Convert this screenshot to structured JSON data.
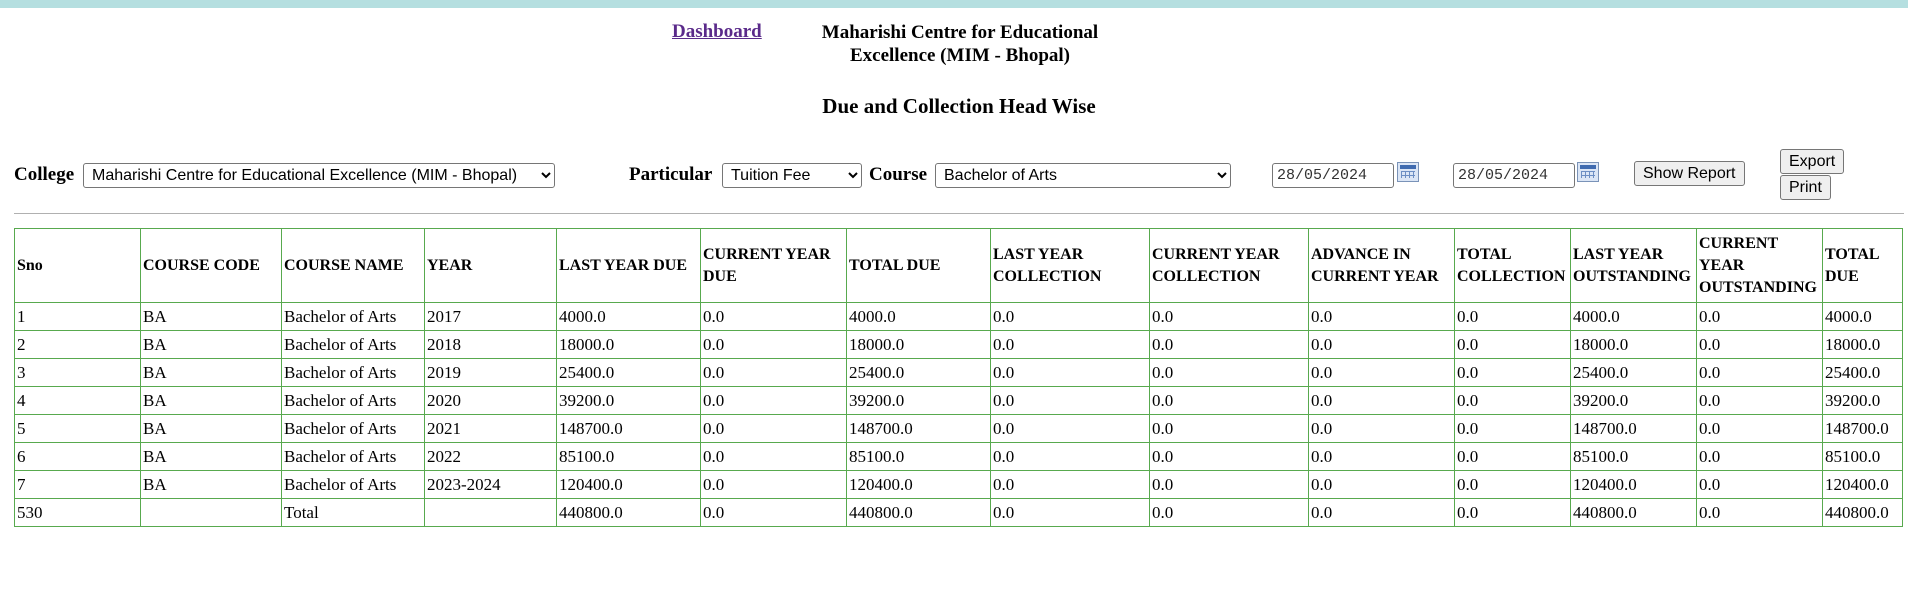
{
  "header": {
    "dashboard_link": "Dashboard",
    "org_line1": "Maharishi Centre for Educational",
    "org_line2": "Excellence (MIM - Bhopal)",
    "page_title": "Due and Collection Head Wise"
  },
  "filters": {
    "college_label": "College",
    "college_value": "Maharishi Centre for Educational Excellence (MIM - Bhopal)",
    "particular_label": "Particular",
    "particular_value": "Tuition Fee",
    "course_label": "Course",
    "course_value": "Bachelor of Arts",
    "from_date": "28/05/2024",
    "to_date": "28/05/2024",
    "show_report_label": "Show Report",
    "export_label": "Export",
    "print_label": "Print"
  },
  "colors": {
    "top_bar": "#b5dfe0",
    "table_border": "#58a94e",
    "link": "#5a2a8a"
  },
  "table": {
    "headers": [
      "Sno",
      "COURSE CODE",
      "COURSE NAME",
      "YEAR",
      "LAST YEAR DUE",
      "CURRENT YEAR DUE",
      "TOTAL DUE",
      "LAST YEAR COLLECTION",
      "CURRENT YEAR COLLECTION",
      "ADVANCE IN CURRENT YEAR",
      "TOTAL COLLECTION",
      "LAST YEAR OUTSTANDING",
      "CURRENT YEAR OUTSTANDING",
      "TOTAL DUE"
    ],
    "rows": [
      [
        "1",
        "BA",
        "Bachelor of Arts",
        "2017",
        "4000.0",
        "0.0",
        "4000.0",
        "0.0",
        "0.0",
        "0.0",
        "0.0",
        "4000.0",
        "0.0",
        "4000.0"
      ],
      [
        "2",
        "BA",
        "Bachelor of Arts",
        "2018",
        "18000.0",
        "0.0",
        "18000.0",
        "0.0",
        "0.0",
        "0.0",
        "0.0",
        "18000.0",
        "0.0",
        "18000.0"
      ],
      [
        "3",
        "BA",
        "Bachelor of Arts",
        "2019",
        "25400.0",
        "0.0",
        "25400.0",
        "0.0",
        "0.0",
        "0.0",
        "0.0",
        "25400.0",
        "0.0",
        "25400.0"
      ],
      [
        "4",
        "BA",
        "Bachelor of Arts",
        "2020",
        "39200.0",
        "0.0",
        "39200.0",
        "0.0",
        "0.0",
        "0.0",
        "0.0",
        "39200.0",
        "0.0",
        "39200.0"
      ],
      [
        "5",
        "BA",
        "Bachelor of Arts",
        "2021",
        "148700.0",
        "0.0",
        "148700.0",
        "0.0",
        "0.0",
        "0.0",
        "0.0",
        "148700.0",
        "0.0",
        "148700.0"
      ],
      [
        "6",
        "BA",
        "Bachelor of Arts",
        "2022",
        "85100.0",
        "0.0",
        "85100.0",
        "0.0",
        "0.0",
        "0.0",
        "0.0",
        "85100.0",
        "0.0",
        "85100.0"
      ],
      [
        "7",
        "BA",
        "Bachelor of Arts",
        "2023-2024",
        "120400.0",
        "0.0",
        "120400.0",
        "0.0",
        "0.0",
        "0.0",
        "0.0",
        "120400.0",
        "0.0",
        "120400.0"
      ]
    ],
    "total_row": [
      "530",
      "",
      "Total",
      "",
      "440800.0",
      "0.0",
      "440800.0",
      "0.0",
      "0.0",
      "0.0",
      "0.0",
      "440800.0",
      "0.0",
      "440800.0"
    ]
  }
}
